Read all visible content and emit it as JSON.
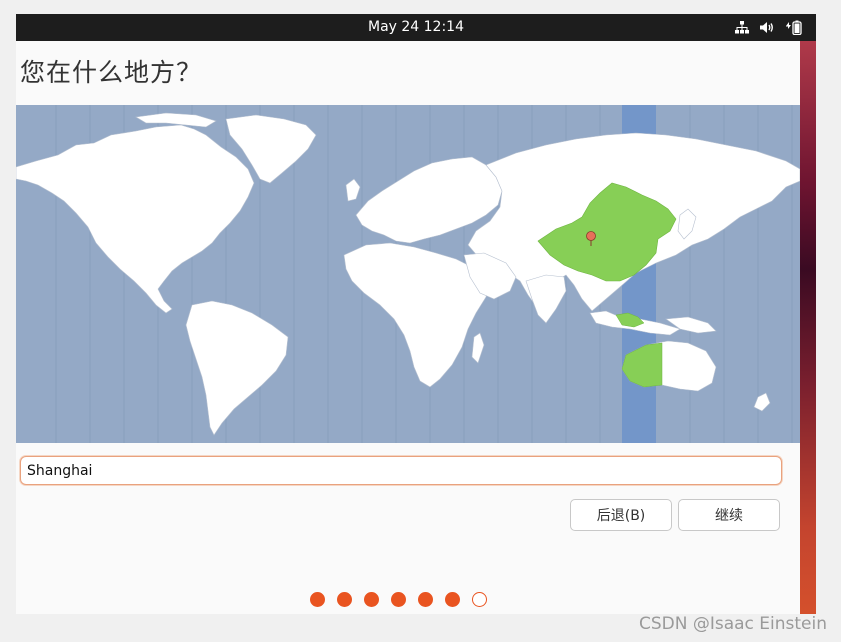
{
  "topbar": {
    "clock": "May 24  12:14",
    "icons": [
      "network-icon",
      "volume-icon",
      "battery-icon"
    ]
  },
  "installer": {
    "title": "您在什么地方？",
    "location_input": {
      "value": "Shanghai",
      "placeholder": ""
    },
    "buttons": {
      "back": "后退(B)",
      "next": "继续"
    },
    "progress": {
      "total_steps": 7,
      "completed_steps": 6
    }
  },
  "map": {
    "selected_region": "Shanghai",
    "colors": {
      "ocean": "#94a9c6",
      "land": "#ffffff",
      "highlight": "#87cf56",
      "timezone_band": "#7396c9",
      "pin": "#e8705a"
    }
  },
  "watermark": "CSDN @Isaac Einstein",
  "colors": {
    "accent": "#e95420",
    "topbar": "#1d1d1d"
  }
}
